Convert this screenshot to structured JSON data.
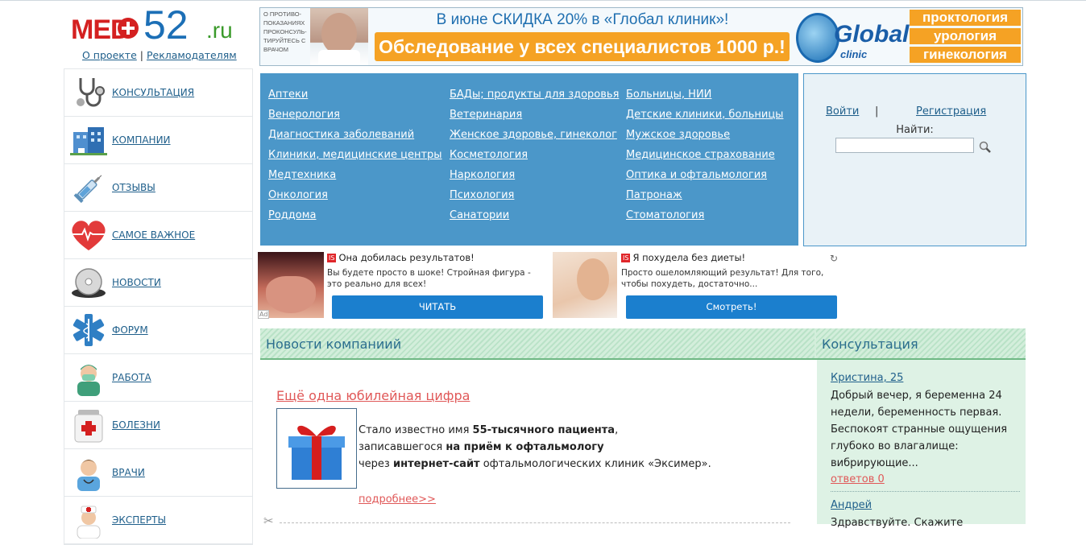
{
  "site": {
    "logo": {
      "med": "MED",
      "num": "52",
      "tld": ".ru"
    },
    "links": {
      "about": "О проекте",
      "separator": "|",
      "advertisers": "Рекламодателям"
    }
  },
  "banner": {
    "warning": "О ПРОТИВО-ПОКАЗАНИЯХ ПРОКОНСУЛЬ-ТИРУЙТЕСЬ С ВРАЧОМ",
    "top_text": "В июне СКИДКА 20% в «Глобал клиник»!",
    "offer": "Обследование у всех специалистов 1000 р.!",
    "brand": "Global",
    "brand_sub": "clinic",
    "tags": [
      "проктология",
      "урология",
      "гинекология"
    ]
  },
  "sidebar": {
    "items": [
      {
        "label": "Консультация",
        "icon": "stethoscope-icon"
      },
      {
        "label": "Компании",
        "icon": "hospital-building-icon"
      },
      {
        "label": "Отзывы",
        "icon": "syringe-icon"
      },
      {
        "label": "Самое важное",
        "icon": "heart-pulse-icon"
      },
      {
        "label": "Новости",
        "icon": "disc-icon"
      },
      {
        "label": "Форум",
        "icon": "medical-star-icon"
      },
      {
        "label": "Работа",
        "icon": "surgeon-icon"
      },
      {
        "label": "Болезни",
        "icon": "first-aid-kit-icon"
      },
      {
        "label": "Врачи",
        "icon": "doctor-icon"
      },
      {
        "label": "Эксперты",
        "icon": "nurse-icon"
      }
    ]
  },
  "categories": {
    "col1": [
      "Аптеки",
      "Венерология",
      "Диагностика заболеваний",
      "Клиники, медицинские центры",
      "Медтехника",
      "Онкология",
      "Роддома"
    ],
    "col2": [
      "БАДы; продукты для здоровья",
      "Ветеринария",
      "Женское здоровье, гинеколог",
      "Косметология",
      "Наркология",
      "Психология",
      "Санатории"
    ],
    "col3": [
      "Больницы, НИИ",
      "Детские клиники, больницы",
      "Мужское здоровье",
      "Медицинское страхование",
      "Оптика и офтальмология",
      "Патронаж",
      "Стоматология"
    ]
  },
  "login": {
    "signin": "Войти",
    "separator": "|",
    "register": "Регистрация",
    "find_label": "Найти:",
    "search_value": ""
  },
  "ads": [
    {
      "badge": "IS",
      "title": "Она добилась результатов!",
      "desc": "Вы будете просто в шоке! Стройная фигура - это реально для всех!",
      "button": "ЧИТАТЬ"
    },
    {
      "badge": "IS",
      "title": "Я похудела без диеты!",
      "desc": "Просто ошеломляющий результат! Для того, чтобы похудеть, достаточно...",
      "button": "Смотреть!"
    }
  ],
  "ads_mark": "Ad",
  "news_section": {
    "title": "Новости компаниий",
    "headline": "Ещё одна юбилейная цифра",
    "body": {
      "line1_pre": "Стало известно имя ",
      "line1_bold": "55-тысячного пациента",
      "line1_post": ",",
      "line2_pre": "записавшегося ",
      "line2_bold": "на приём к офтальмологу",
      "line3_pre": "через ",
      "line3_bold": "интернет-сайт",
      "line3_post": " офтальмологических клиник «Эксимер»."
    },
    "more": "подробнее>>"
  },
  "consult_section": {
    "title": "Консультация",
    "entries": [
      {
        "name": "Кристина, 25",
        "question": "Добрый вечер, я беременна 24 недели, беременность первая. Беспокоят странные ощущения глубоко во влагалище: вибрирующие...",
        "answers": "ответов 0"
      },
      {
        "name": "Андрей",
        "question": "Здравствуйте. Скажите"
      }
    ]
  },
  "colors": {
    "nav_blue": "#4b97c9",
    "orange": "#f5a224",
    "news_red": "#e05858",
    "green_bg": "#def2e5"
  }
}
